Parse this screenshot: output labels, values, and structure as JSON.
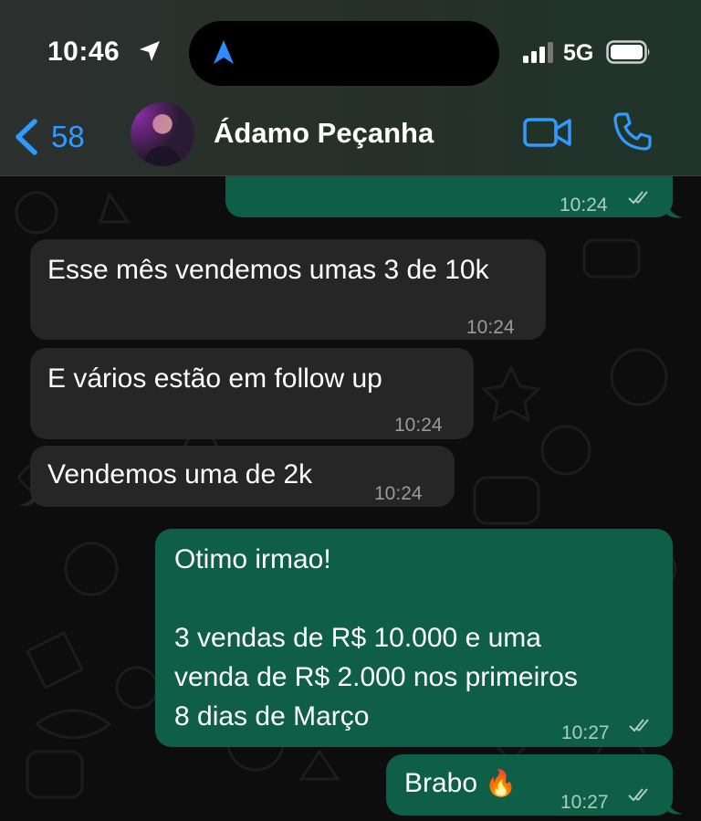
{
  "status_bar": {
    "time": "10:46",
    "network": "5G",
    "icons": [
      "location-arrow-icon",
      "navigation-arrow-icon",
      "signal-bars-icon",
      "battery-icon"
    ]
  },
  "header": {
    "back_count": "58",
    "contact_name": "Ádamo Peçanha",
    "icons": [
      "chevron-left-icon",
      "video-camera-icon",
      "phone-icon"
    ],
    "accent_color": "#2f9bff"
  },
  "messages": [
    {
      "direction": "outgoing",
      "text": "",
      "time": "10:24",
      "read": true
    },
    {
      "direction": "incoming",
      "text": "Esse mês vendemos umas 3 de 10k",
      "time": "10:24"
    },
    {
      "direction": "incoming",
      "text": "E vários estão em follow up",
      "time": "10:24"
    },
    {
      "direction": "incoming",
      "text": "Vendemos uma de 2k",
      "time": "10:24"
    },
    {
      "direction": "outgoing",
      "lines": [
        "Otimo irmao!",
        "",
        "3 vendas de R$ 10.000 e uma",
        "venda de R$ 2.000 nos primeiros",
        "8 dias de Março"
      ],
      "time": "10:27",
      "read": true
    },
    {
      "direction": "outgoing",
      "text": "Brabo",
      "emoji": "🔥",
      "time": "10:27",
      "read": true
    }
  ],
  "colors": {
    "incoming_bubble": "#262626",
    "outgoing_bubble": "#0f5e48",
    "background": "#0d0d0d"
  }
}
